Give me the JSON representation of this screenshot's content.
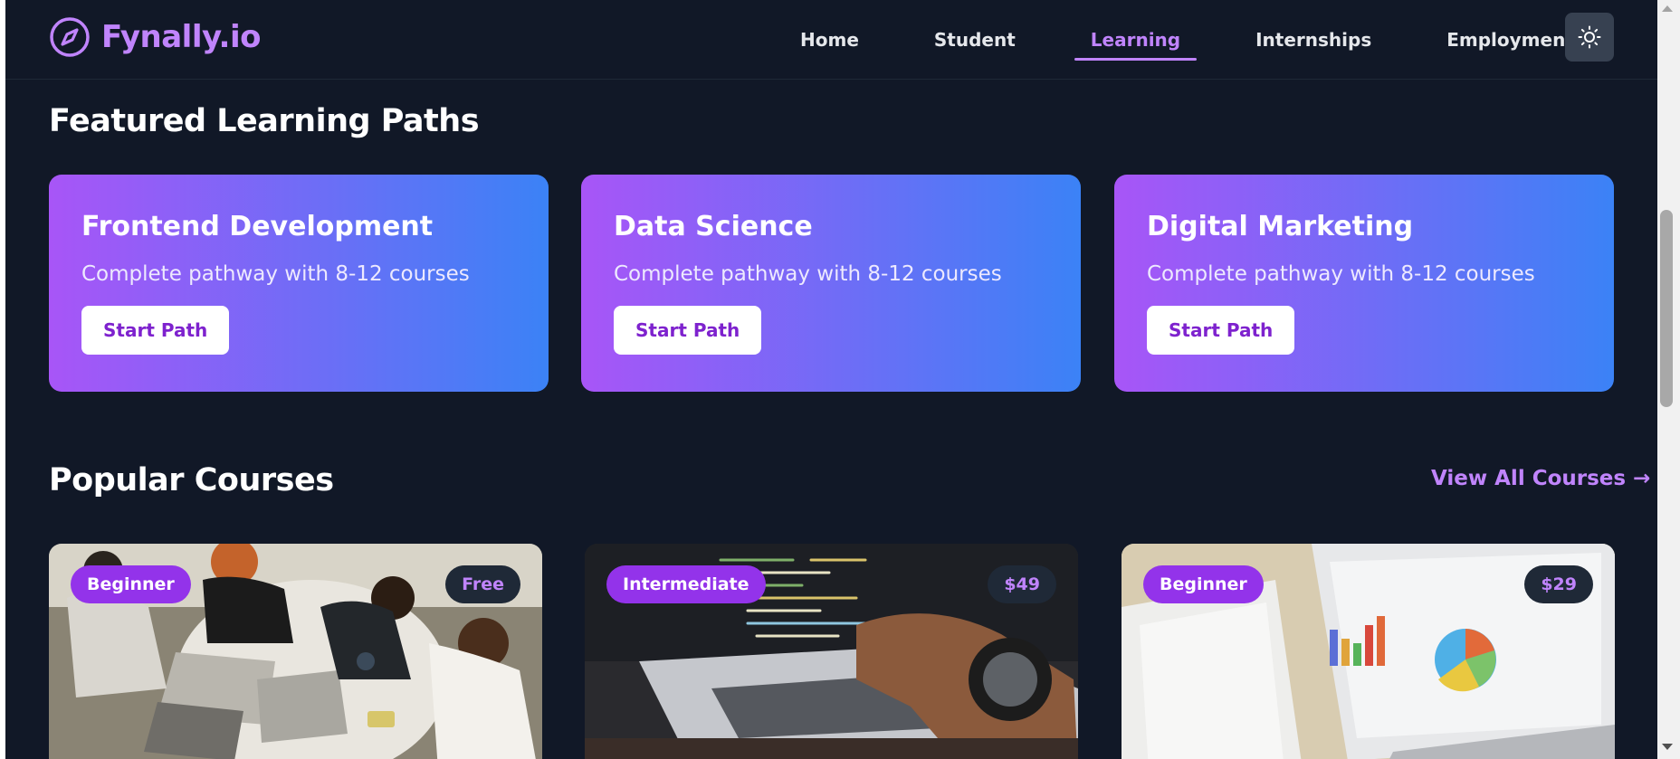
{
  "brand": {
    "name": "Fynally.io",
    "accent": "#c084fc",
    "icon": "compass-icon"
  },
  "nav": {
    "items": [
      {
        "label": "Home",
        "active": false
      },
      {
        "label": "Student",
        "active": false
      },
      {
        "label": "Learning",
        "active": true
      },
      {
        "label": "Internships",
        "active": false
      },
      {
        "label": "Employment",
        "active": false
      }
    ],
    "theme_toggle_icon": "sun-icon"
  },
  "featured": {
    "title": "Featured Learning Paths",
    "paths": [
      {
        "title": "Frontend Development",
        "description": "Complete pathway with 8-12 courses",
        "button": "Start Path"
      },
      {
        "title": "Data Science",
        "description": "Complete pathway with 8-12 courses",
        "button": "Start Path"
      },
      {
        "title": "Digital Marketing",
        "description": "Complete pathway with 8-12 courses",
        "button": "Start Path"
      }
    ],
    "gradient": [
      "#a855f7",
      "#3b82f6"
    ]
  },
  "popular": {
    "title": "Popular Courses",
    "view_all": "View All Courses →",
    "courses": [
      {
        "level": "Beginner",
        "price": "Free",
        "image": "students-laptops-photo"
      },
      {
        "level": "Intermediate",
        "price": "$49",
        "image": "coding-laptop-photo"
      },
      {
        "level": "Beginner",
        "price": "$29",
        "image": "analytics-laptop-photo"
      }
    ]
  }
}
